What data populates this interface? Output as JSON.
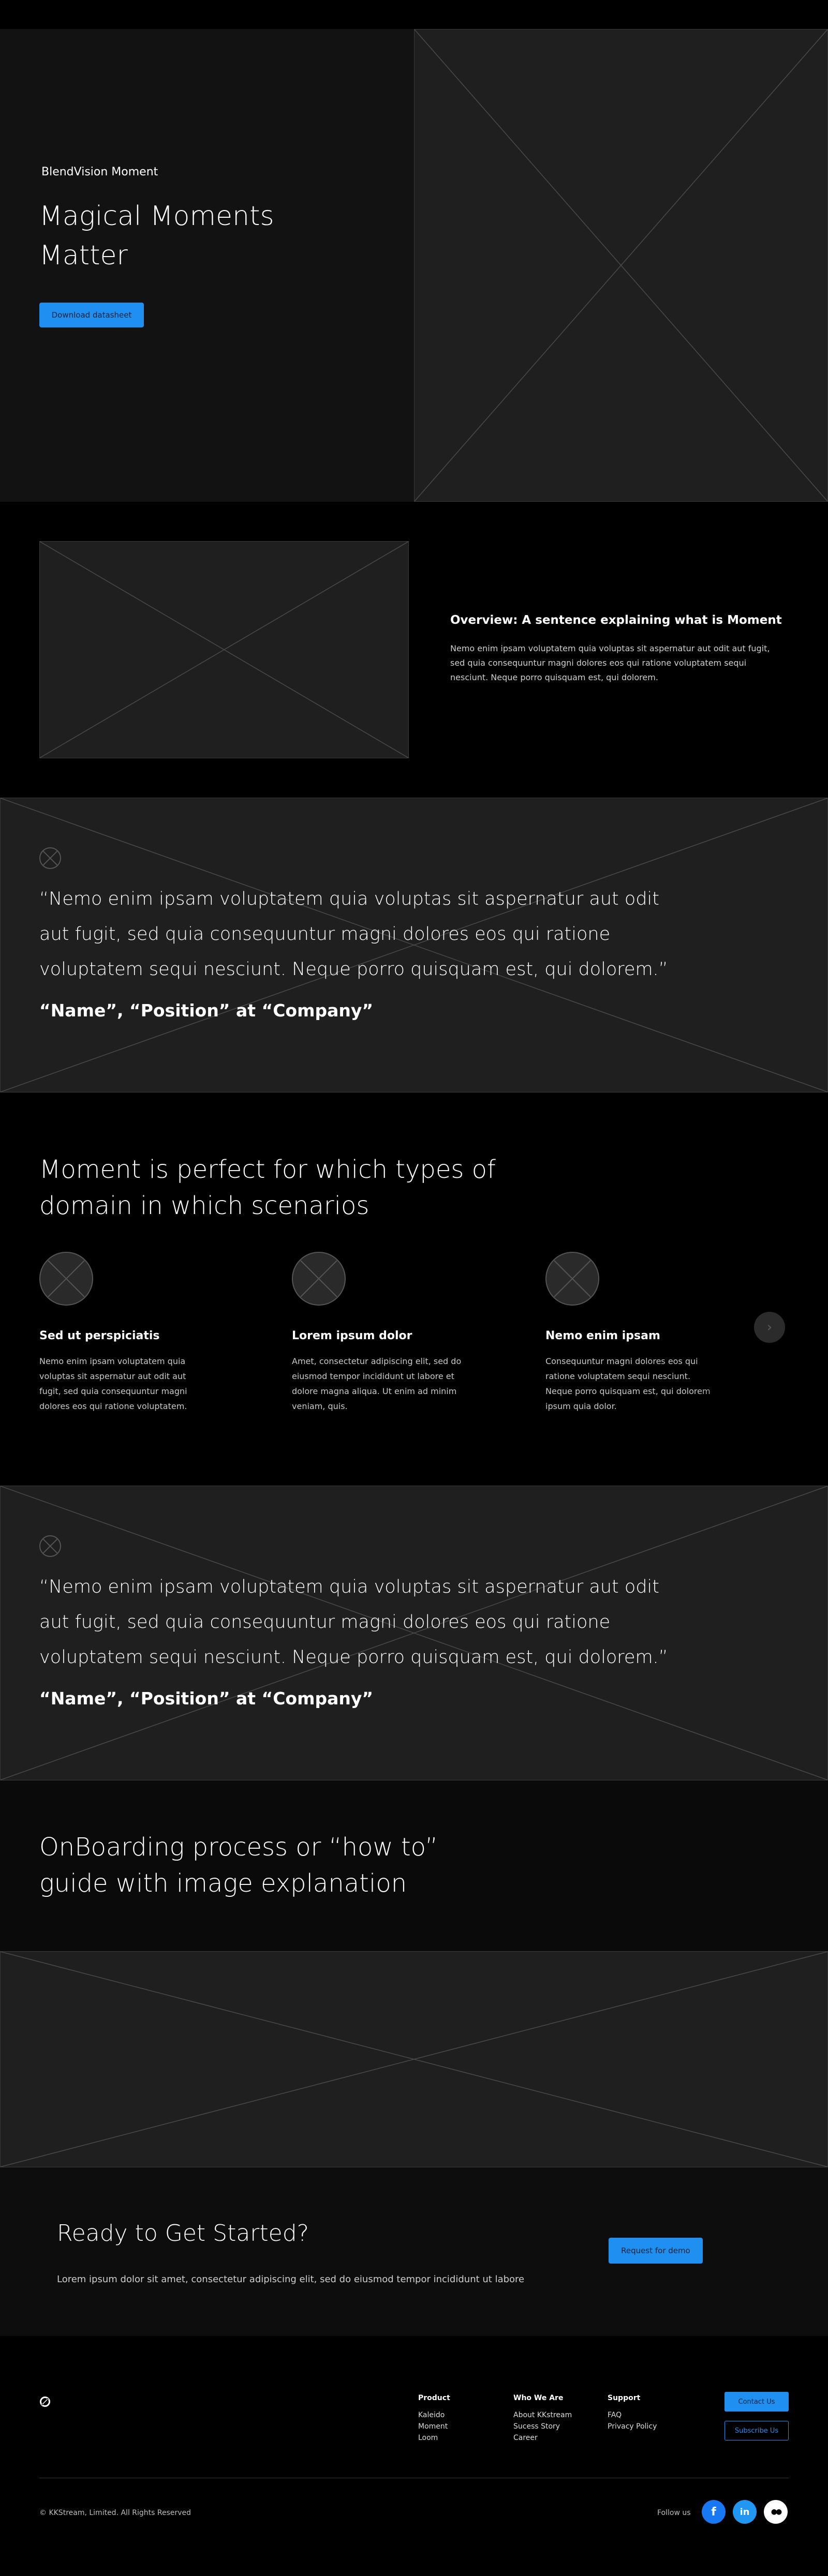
{
  "hero": {
    "eyebrow": "BlendVision Moment",
    "title": "Magical Moments Matter",
    "button_label": "Download datasheet"
  },
  "overview": {
    "title": "Overview: A sentence explaining what is Moment",
    "body": "Nemo enim ipsam voluptatem quia voluptas sit aspernatur aut odit aut fugit, sed quia consequuntur magni dolores eos qui ratione voluptatem sequi nesciunt. Neque porro quisquam est, qui dolorem."
  },
  "quotes": [
    {
      "text": "“Nemo enim ipsam voluptatem quia voluptas sit aspernatur aut odit aut fugit, sed quia consequuntur magni dolores eos qui ratione voluptatem sequi nesciunt. Neque porro quisquam est, qui dolorem.”",
      "author": "“Name”, “Position” at “Company”"
    },
    {
      "text": "“Nemo enim ipsam voluptatem quia voluptas sit aspernatur aut odit aut fugit, sed quia consequuntur magni dolores eos qui ratione voluptatem sequi nesciunt. Neque porro quisquam est, qui dolorem.”",
      "author": "“Name”, “Position” at “Company”"
    }
  ],
  "domain": {
    "title": "Moment is perfect for which types of domain in which scenarios",
    "cards": [
      {
        "title": "Sed ut perspiciatis",
        "body": "Nemo enim ipsam voluptatem quia voluptas sit aspernatur aut odit aut fugit, sed quia consequuntur magni dolores eos qui ratione voluptatem."
      },
      {
        "title": "Lorem ipsum dolor",
        "body": "Amet, consectetur adipiscing elit, sed do eiusmod tempor incididunt ut labore et dolore magna aliqua. Ut enim ad minim veniam, quis."
      },
      {
        "title": "Nemo enim ipsam",
        "body": "Consequuntur magni dolores eos qui ratione voluptatem sequi nesciunt. Neque porro quisquam est, qui dolorem ipsum quia dolor."
      }
    ],
    "next_icon": "chevron-right-icon"
  },
  "onboarding": {
    "title": "OnBoarding process or “how to” guide with image explanation"
  },
  "cta": {
    "title": "Ready to Get Started?",
    "body": "Lorem ipsum dolor sit amet, consectetur adipiscing elit, sed do eiusmod tempor incididunt ut labore",
    "button_label": "Request for demo"
  },
  "footer": {
    "columns": [
      {
        "heading": "Product",
        "links": [
          "Kaleido",
          "Moment",
          "Loom"
        ]
      },
      {
        "heading": "Who We Are",
        "links": [
          "About KKstream",
          "Sucess Story",
          "Career"
        ]
      },
      {
        "heading": "Support",
        "links": [
          "FAQ",
          "Privacy Policy"
        ]
      }
    ],
    "contact_label": "Contact Us",
    "subscribe_label": "Subscribe Us",
    "copyright": "© KKStream, Limited. All Rights Reserved",
    "follow_label": "Follow us",
    "social": [
      {
        "icon": "facebook-icon",
        "glyph": "f"
      },
      {
        "icon": "linkedin-icon",
        "glyph": "in"
      },
      {
        "icon": "medium-icon",
        "glyph": "●●"
      }
    ]
  },
  "colors": {
    "accent": "#1f8ff0",
    "background": "#000000",
    "placeholder": "#1f1f1f",
    "facebook": "#1877f2",
    "linkedin": "#2196f3"
  }
}
